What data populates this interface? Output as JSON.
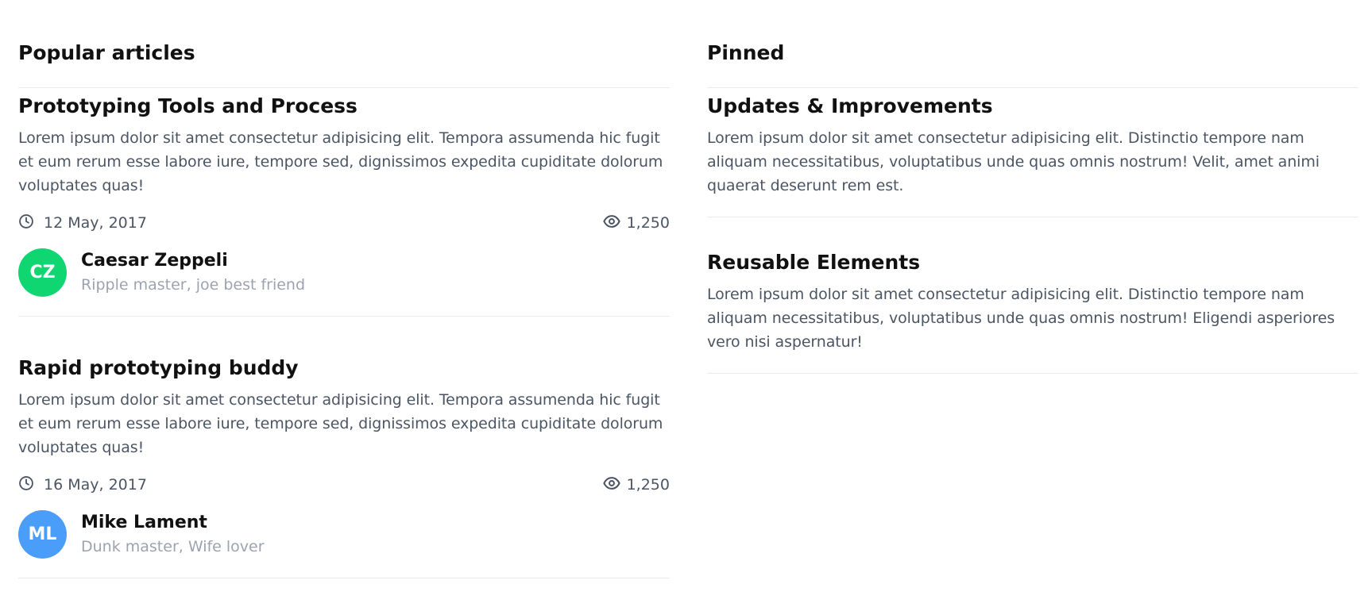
{
  "popular": {
    "title": "Popular articles",
    "articles": [
      {
        "title": "Prototyping Tools and Process",
        "excerpt": "Lorem ipsum dolor sit amet consectetur adipisicing elit. Tempora assumenda hic fugit et eum rerum esse labore iure, tempore sed, dignissimos expedita cupiditate dolorum voluptates quas!",
        "date": "12 May, 2017",
        "views": "1,250",
        "author": {
          "initials": "CZ",
          "name": "Caesar Zeppeli",
          "role": "Ripple master, joe best friend",
          "color": "#0fd671"
        }
      },
      {
        "title": "Rapid prototyping buddy",
        "excerpt": "Lorem ipsum dolor sit amet consectetur adipisicing elit. Tempora assumenda hic fugit et eum rerum esse labore iure, tempore sed, dignissimos expedita cupiditate dolorum voluptates quas!",
        "date": "16 May, 2017",
        "views": "1,250",
        "author": {
          "initials": "ML",
          "name": "Mike Lament",
          "role": "Dunk master, Wife lover",
          "color": "#4a9df8"
        }
      }
    ]
  },
  "pinned": {
    "title": "Pinned",
    "items": [
      {
        "title": "Updates & Improvements",
        "excerpt": "Lorem ipsum dolor sit amet consectetur adipisicing elit. Distinctio tempore nam aliquam necessitatibus, voluptatibus unde quas omnis nostrum! Velit, amet animi quaerat deserunt rem est."
      },
      {
        "title": "Reusable Elements",
        "excerpt": "Lorem ipsum dolor sit amet consectetur adipisicing elit. Distinctio tempore nam aliquam necessitatibus, voluptatibus unde quas omnis nostrum! Eligendi asperiores vero nisi aspernatur!"
      }
    ]
  },
  "icons": {
    "date": "clock-icon",
    "views": "eye-icon"
  },
  "colors": {
    "text": "#111111",
    "muted": "#4b5563",
    "light": "#9ca3af",
    "divider": "#e8eaee"
  }
}
